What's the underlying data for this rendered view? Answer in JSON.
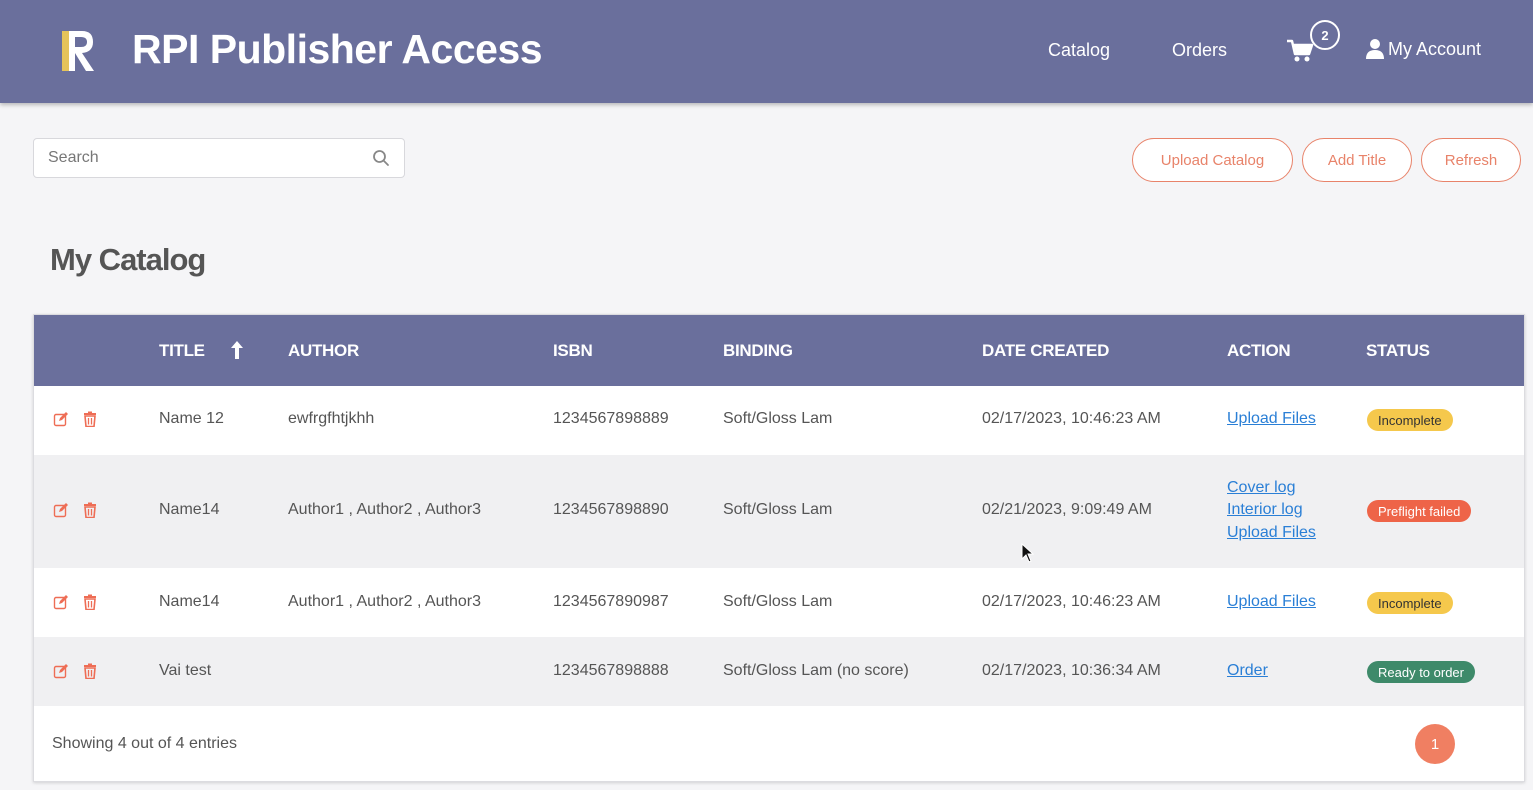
{
  "header": {
    "app_title": "RPI Publisher Access",
    "nav": {
      "catalog": "Catalog",
      "orders": "Orders",
      "account": "My Account"
    },
    "cart_count": "2",
    "logo_letter": "R"
  },
  "toolbar": {
    "search_placeholder": "Search",
    "upload_catalog": "Upload Catalog",
    "add_title": "Add Title",
    "refresh": "Refresh"
  },
  "page_title": "My Catalog",
  "table": {
    "columns": [
      "TITLE",
      "AUTHOR",
      "ISBN",
      "BINDING",
      "DATE CREATED",
      "ACTION",
      "STATUS"
    ],
    "sort": {
      "column": "TITLE",
      "direction": "ascending"
    },
    "rows": [
      {
        "title": "Name 12",
        "author": "ewfrgfhtjkhh",
        "isbn": "1234567898889",
        "binding": "Soft/Gloss Lam",
        "date_created": "02/17/2023, 10:46:23 AM",
        "actions": [
          "Upload Files"
        ],
        "status": "Incomplete"
      },
      {
        "title": "Name14",
        "author": "Author1 , Author2 , Author3",
        "isbn": "1234567898890",
        "binding": "Soft/Gloss Lam",
        "date_created": "02/21/2023, 9:09:49 AM",
        "actions": [
          "Cover log",
          "Interior log",
          "Upload Files"
        ],
        "status": "Preflight failed"
      },
      {
        "title": "Name14",
        "author": "Author1 , Author2 , Author3",
        "isbn": "1234567890987",
        "binding": "Soft/Gloss Lam",
        "date_created": "02/17/2023, 10:46:23 AM",
        "actions": [
          "Upload Files"
        ],
        "status": "Incomplete"
      },
      {
        "title": "Vai test",
        "author": "",
        "isbn": "1234567898888",
        "binding": "Soft/Gloss Lam (no score)",
        "date_created": "02/17/2023, 10:36:34 AM",
        "actions": [
          "Order"
        ],
        "status": "Ready to order"
      }
    ],
    "footer_text": "Showing 4 out of 4 entries",
    "current_page": "1"
  },
  "colors": {
    "header_bg": "#6a6f9c",
    "accent": "#e8836a",
    "link": "#2a7fd6",
    "status_incomplete": "#f5c84c",
    "status_failed": "#ee6448",
    "status_ready": "#3e8a6a"
  },
  "icons": [
    "logo-r-icon",
    "cart-icon",
    "user-icon",
    "search-icon",
    "sort-arrow-up-icon",
    "edit-icon",
    "trash-icon",
    "mouse-cursor-icon"
  ]
}
